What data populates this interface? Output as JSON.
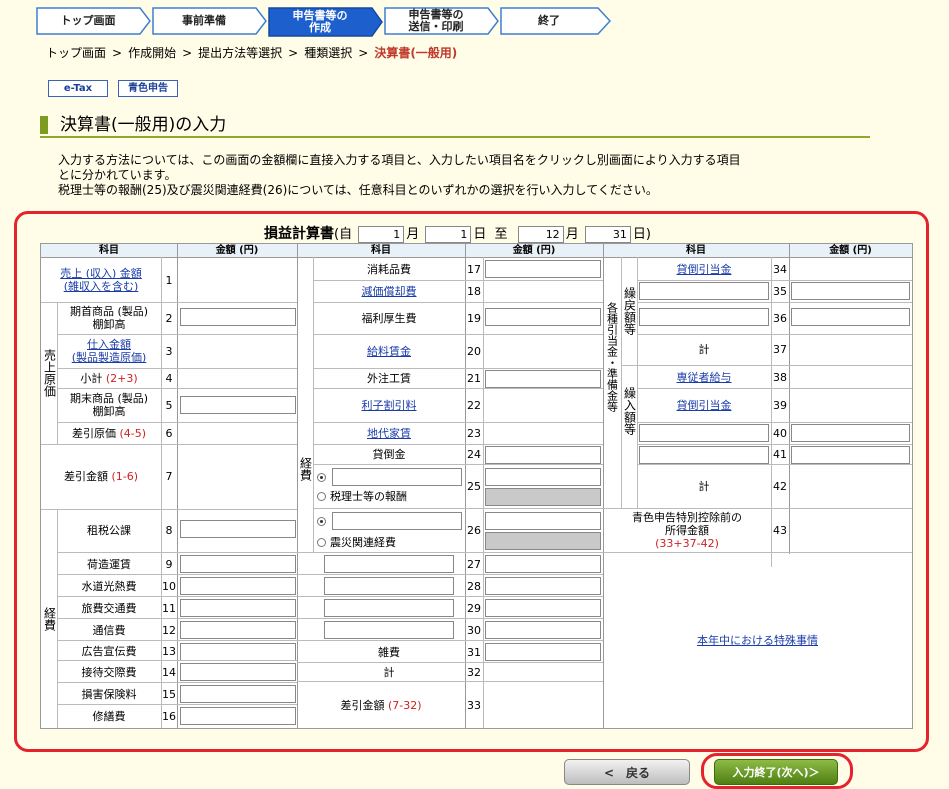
{
  "steps": [
    {
      "label": "トップ画面",
      "current": false
    },
    {
      "label": "事前準備",
      "current": false
    },
    {
      "label": "申告書等の\n作成",
      "current": true
    },
    {
      "label": "申告書等の\n送信・印刷",
      "current": false
    },
    {
      "label": "終了",
      "current": false
    }
  ],
  "breadcrumb": [
    "トップ画面",
    "作成開始",
    "提出方法等選択",
    "種類選択",
    "決算書(一般用)"
  ],
  "breadcrumb_sep": ">",
  "badges": {
    "etax": "e-Tax",
    "blue": "青色申告"
  },
  "section_title": "決算書(一般用)の入力",
  "description": [
    "入力する方法については、この画面の金額欄に直接入力する項目と、入力したい項目名をクリックし別画面により入力する項目",
    "とに分かれています。",
    "税理士等の報酬(25)及び震災関連経費(26)については、任意科目とのいずれかの選択を行い入力してください。"
  ],
  "statement": {
    "title": "損益計算書",
    "from_prefix": "(自",
    "from_month": "1",
    "month_label": "月",
    "from_day": "1",
    "day_label": "日",
    "to_label": "至",
    "to_month": "12",
    "to_day": "31",
    "close": "日)"
  },
  "headers": {
    "item": "科目",
    "amount": "金額 (円)"
  },
  "col1": {
    "sales": "売上 (収入) 金額\n(雑収入を含む)",
    "cogs_group": "売上原価",
    "opening_inventory": "期首商品 (製品)\n棚卸高",
    "purchases": "仕入金額\n(製品製造原価)",
    "subtotal": "小計",
    "subtotal_formula": "(2+3)",
    "closing_inventory": "期末商品 (製品)\n棚卸高",
    "cost": "差引原価",
    "cost_formula": "(4-5)",
    "gross": "差引金額",
    "gross_formula": "(1-6)",
    "expense_group": "経費",
    "taxes": "租税公課",
    "freight": "荷造運賃",
    "utilities": "水道光熱費",
    "travel": "旅費交通費",
    "communication": "通信費",
    "advertising": "広告宣伝費",
    "entertainment": "接待交際費",
    "insurance": "損害保険料",
    "repairs": "修繕費"
  },
  "col2": {
    "expense_group": "経費",
    "supplies": "消耗品費",
    "depreciation": "減価償却費",
    "welfare": "福利厚生費",
    "wages": "給料賃金",
    "outsourcing": "外注工賃",
    "interest": "利子割引料",
    "rent": "地代家賃",
    "bad_debt": "貸倒金",
    "tax_accountant": "税理士等の報酬",
    "disaster": "震災関連経費",
    "misc": "雑費",
    "total": "計",
    "net": "差引金額",
    "net_formula": "(7-32)"
  },
  "col3": {
    "reserve_group": "各種引当金・準備金等",
    "reversal_group": "繰戻額等",
    "provision_group": "繰入額等",
    "bad_debt_allowance": "貸倒引当金",
    "total": "計",
    "family_wages": "専従者給与",
    "income_before": "青色申告特別控除前の\n所得金額",
    "income_formula": "(33+37-42)",
    "special_link": "本年中における特殊事情"
  },
  "line_numbers": {
    "c1": [
      "1",
      "2",
      "3",
      "4",
      "5",
      "6",
      "7",
      "8",
      "9",
      "10",
      "11",
      "12",
      "13",
      "14",
      "15",
      "16"
    ],
    "c2": [
      "17",
      "18",
      "19",
      "20",
      "21",
      "22",
      "23",
      "24",
      "25",
      "26",
      "27",
      "28",
      "29",
      "30",
      "31",
      "32",
      "33"
    ],
    "c3": [
      "34",
      "35",
      "36",
      "37",
      "38",
      "39",
      "40",
      "41",
      "42",
      "43"
    ]
  },
  "buttons": {
    "back": "<　戻る",
    "next": "入力終了(次へ)＞"
  }
}
